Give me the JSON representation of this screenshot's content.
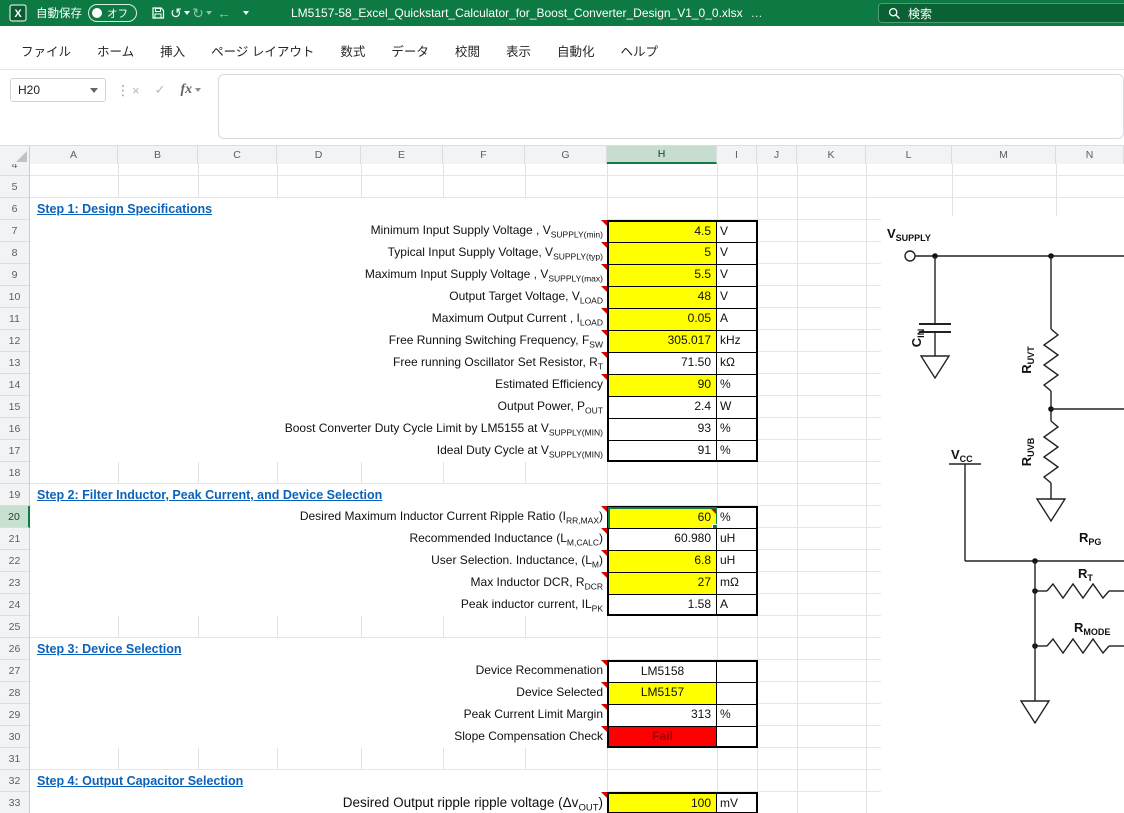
{
  "titlebar": {
    "autosave_label": "自動保存",
    "autosave_state": "オフ",
    "filename": "LM5157-58_Excel_Quickstart_Calculator_for_Boost_Converter_Design_V1_0_0.xlsx",
    "filename_suffix": "…",
    "search_label": "検索"
  },
  "icons": {
    "excel_logo": "X",
    "undo": "↺",
    "redo": "↻",
    "back": "←",
    "divider": "⋮",
    "cancel": "×",
    "enter": "✓",
    "fx": "fx"
  },
  "ribbon": {
    "tabs": [
      {
        "id": "file",
        "label": "ファイル"
      },
      {
        "id": "home",
        "label": "ホーム"
      },
      {
        "id": "insert",
        "label": "挿入"
      },
      {
        "id": "page-layout",
        "label": "ページ レイアウト"
      },
      {
        "id": "formulas",
        "label": "数式"
      },
      {
        "id": "data",
        "label": "データ"
      },
      {
        "id": "review",
        "label": "校閲"
      },
      {
        "id": "view",
        "label": "表示"
      },
      {
        "id": "automate",
        "label": "自動化"
      },
      {
        "id": "help",
        "label": "ヘルプ"
      }
    ]
  },
  "formula_bar": {
    "cell_reference": "H20",
    "formula": ""
  },
  "grid": {
    "columns": [
      "A",
      "B",
      "C",
      "D",
      "E",
      "F",
      "G",
      "H",
      "I",
      "J",
      "K",
      "L",
      "M",
      "N"
    ],
    "selected_column": "H",
    "selected_row": 20,
    "first_row": 4,
    "last_row": 33
  },
  "rows": [
    {
      "n": 6,
      "type": "section",
      "text": "Step 1: Design Specifications"
    },
    {
      "n": 7,
      "type": "data",
      "label": [
        {
          "t": "Minimum Input Supply Voltage , V"
        },
        {
          "t": "SUPPLY(min)",
          "sub": true
        }
      ],
      "value": "4.5",
      "unit": "V",
      "fill": "yellow",
      "note": true,
      "bs": true
    },
    {
      "n": 8,
      "type": "data",
      "label": [
        {
          "t": "Typical Input Supply Voltage, V"
        },
        {
          "t": "SUPPLY(typ)",
          "sub": true
        }
      ],
      "value": "5",
      "unit": "V",
      "fill": "yellow",
      "note": true
    },
    {
      "n": 9,
      "type": "data",
      "label": [
        {
          "t": "Maximum Input Supply Voltage , V"
        },
        {
          "t": "SUPPLY(max)",
          "sub": true
        }
      ],
      "value": "5.5",
      "unit": "V",
      "fill": "yellow",
      "note": true
    },
    {
      "n": 10,
      "type": "data",
      "label": [
        {
          "t": "Output Target Voltage, V"
        },
        {
          "t": "LOAD",
          "sub": true
        }
      ],
      "value": "48",
      "unit": "V",
      "fill": "yellow",
      "note": true
    },
    {
      "n": 11,
      "type": "data",
      "label": [
        {
          "t": "Maximum Output Current , I"
        },
        {
          "t": "LOAD",
          "sub": true
        }
      ],
      "value": "0.05",
      "unit": "A",
      "fill": "yellow",
      "note": true
    },
    {
      "n": 12,
      "type": "data",
      "label": [
        {
          "t": "Free Running Switching Frequency, F"
        },
        {
          "t": "SW",
          "sub": true
        }
      ],
      "value": "305.017",
      "unit": "kHz",
      "fill": "yellow",
      "note": true
    },
    {
      "n": 13,
      "type": "data",
      "label": [
        {
          "t": "Free running Oscillator Set Resistor, R"
        },
        {
          "t": "T",
          "sub": true
        }
      ],
      "value": "71.50",
      "unit": "kΩ",
      "fill": "white",
      "note": true
    },
    {
      "n": 14,
      "type": "data",
      "label": [
        {
          "t": "Estimated Efficiency"
        }
      ],
      "value": "90",
      "unit": "%",
      "fill": "yellow",
      "note": true
    },
    {
      "n": 15,
      "type": "data",
      "label": [
        {
          "t": "Output Power, P"
        },
        {
          "t": "OUT",
          "sub": true
        }
      ],
      "value": "2.4",
      "unit": "W",
      "fill": "white"
    },
    {
      "n": 16,
      "type": "data",
      "label": [
        {
          "t": "Boost Converter Duty Cycle Limit by LM5155 at V"
        },
        {
          "t": "SUPPLY(MIN)",
          "sub": true
        }
      ],
      "value": "93",
      "unit": "%",
      "fill": "white"
    },
    {
      "n": 17,
      "type": "data",
      "label": [
        {
          "t": "Ideal Duty Cycle at V"
        },
        {
          "t": "SUPPLY(MIN)",
          "sub": true
        }
      ],
      "value": "91",
      "unit": "%",
      "fill": "white",
      "be": true
    },
    {
      "n": 19,
      "type": "section",
      "text": "Step 2: Filter Inductor, Peak Current, and Device Selection"
    },
    {
      "n": 20,
      "type": "data",
      "label": [
        {
          "t": "Desired Maximum Inductor Current Ripple Ratio (I"
        },
        {
          "t": "RR,MAX",
          "sub": true
        },
        {
          "t": ")"
        }
      ],
      "value": "60",
      "unit": "%",
      "fill": "yellow",
      "note": true,
      "vnote": true,
      "bs": true
    },
    {
      "n": 21,
      "type": "data",
      "label": [
        {
          "t": "Recommended Inductance (L"
        },
        {
          "t": "M,CALC",
          "sub": true
        },
        {
          "t": ")"
        }
      ],
      "value": "60.980",
      "unit": "uH",
      "fill": "white",
      "note": true
    },
    {
      "n": 22,
      "type": "data",
      "label": [
        {
          "t": "User Selection. Inductance, (L"
        },
        {
          "t": "M",
          "sub": true
        },
        {
          "t": ")"
        }
      ],
      "value": "6.8",
      "unit": "uH",
      "fill": "yellow",
      "note": true
    },
    {
      "n": 23,
      "type": "data",
      "label": [
        {
          "t": "Max Inductor DCR, R"
        },
        {
          "t": "DCR",
          "sub": true
        }
      ],
      "value": "27",
      "unit": "mΩ",
      "fill": "yellow",
      "note": true
    },
    {
      "n": 24,
      "type": "data",
      "label": [
        {
          "t": "Peak inductor current, IL"
        },
        {
          "t": "PK",
          "sub": true
        }
      ],
      "value": "1.58",
      "unit": "A",
      "fill": "white",
      "be": true
    },
    {
      "n": 26,
      "type": "section",
      "text": "Step 3: Device Selection"
    },
    {
      "n": 27,
      "type": "data",
      "label": [
        {
          "t": "Device Recommenation"
        }
      ],
      "value": "LM5158",
      "unit": "",
      "fill": "white",
      "note": true,
      "align": "center",
      "bs": true
    },
    {
      "n": 28,
      "type": "data",
      "label": [
        {
          "t": "Device Selected"
        }
      ],
      "value": "LM5157",
      "unit": "",
      "fill": "yellow",
      "note": true,
      "align": "center"
    },
    {
      "n": 29,
      "type": "data",
      "label": [
        {
          "t": "Peak Current Limit Margin"
        }
      ],
      "value": "313",
      "unit": "%",
      "fill": "white",
      "note": true
    },
    {
      "n": 30,
      "type": "data",
      "label": [
        {
          "t": "Slope Compensation Check"
        }
      ],
      "value": "Fail",
      "unit": "",
      "fill": "red",
      "note": true,
      "align": "center",
      "be": true
    },
    {
      "n": 32,
      "type": "section",
      "text": "Step 4: Output Capacitor Selection"
    },
    {
      "n": 33,
      "type": "data",
      "label": [
        {
          "t": "Desired Output ripple ripple voltage (Δv"
        },
        {
          "t": "OUT",
          "sub": true
        },
        {
          "t": ")"
        }
      ],
      "value": "100",
      "unit": "mV",
      "fill": "yellow",
      "note": true,
      "big": true,
      "bs": true,
      "be": true
    }
  ],
  "diagram": {
    "vsupply": {
      "main": "V",
      "sub": "SUPPLY"
    },
    "cin": {
      "main": "C",
      "sub": "IN"
    },
    "ruvt": {
      "main": "R",
      "sub": "UVT"
    },
    "ruvb": {
      "main": "R",
      "sub": "UVB"
    },
    "vcc": {
      "main": "V",
      "sub": "CC"
    },
    "rpg": {
      "main": "R",
      "sub": "PG"
    },
    "rt": {
      "main": "R",
      "sub": "T"
    },
    "rmode": {
      "main": "R",
      "sub": "MODE"
    }
  },
  "colors": {
    "accent": "#107C41",
    "input_fill": "#FFFF00",
    "error_fill": "#FF0000",
    "section_text": "#0B62BB"
  }
}
